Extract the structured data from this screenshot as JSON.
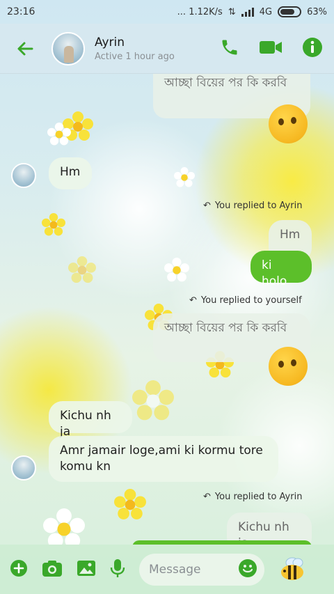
{
  "statusbar": {
    "time": "23:16",
    "network_speed": "... 1.12K/s",
    "network_type": "4G",
    "battery": "63%"
  },
  "header": {
    "name": "Ayrin",
    "status": "Active 1 hour ago"
  },
  "messages": [
    {
      "id": "quote_top",
      "text": "আচ্ছা বিয়ের পর কি করবি"
    },
    {
      "id": "hm_in",
      "text": "Hm"
    },
    {
      "id": "reply_note_1",
      "text": "You replied to Ayrin"
    },
    {
      "id": "quote_hm",
      "text": "Hm"
    },
    {
      "id": "ki_holo",
      "text": "ki holo"
    },
    {
      "id": "reply_note_2",
      "text": "You replied to yourself"
    },
    {
      "id": "quote_mid",
      "text": "আচ্ছা বিয়ের পর কি করবি"
    },
    {
      "id": "kichu",
      "text": "Kichu nh ja"
    },
    {
      "id": "amr",
      "text": "Amr jamair loge,ami ki kormu tore komu kn"
    },
    {
      "id": "reply_note_3",
      "text": "You replied to Ayrin"
    },
    {
      "id": "quote_kichu",
      "text": "Kichu nh ja"
    }
  ],
  "composer": {
    "placeholder": "Message"
  },
  "colors": {
    "accent": "#5cbf2a",
    "icon": "#3aa82a"
  }
}
